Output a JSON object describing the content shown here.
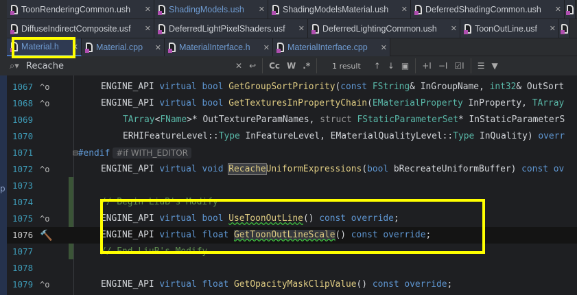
{
  "tabs_row1": [
    {
      "label": "ToonRenderingCommon.ush"
    },
    {
      "label": "ShadingModels.ush"
    },
    {
      "label": "ShadingModelsMaterial.ush"
    },
    {
      "label": "DeferredShadingCommon.ush"
    }
  ],
  "tabs_row2": [
    {
      "label": "DiffuseIndirectComposite.usf"
    },
    {
      "label": "DeferredLightPixelShaders.usf"
    },
    {
      "label": "DeferredLightingCommon.ush"
    },
    {
      "label": "ToonOutLine.usf"
    }
  ],
  "tabs_row3": [
    {
      "label": "Material.h"
    },
    {
      "label": "Material.cpp"
    },
    {
      "label": "MaterialInterface.h"
    },
    {
      "label": "MaterialInterface.cpp"
    }
  ],
  "search": {
    "value": "Recache",
    "case": "Cc",
    "words": "W",
    "regex": ".*",
    "results": "1 result"
  },
  "side_letter": "p",
  "lines": [
    "1067",
    "1068",
    "1069",
    "1070",
    "1071",
    "1072",
    "1073",
    "1074",
    "1075",
    "1076",
    "1077",
    "1078",
    "1079"
  ],
  "code": {
    "l1067": {
      "a": "ENGINE_API ",
      "b": "virtual bool ",
      "c": "GetGroupSortPriority",
      "d": "(",
      "e": "const ",
      "f": "FString",
      "g": "& InGroupName, ",
      "h": "int32",
      "i": "& OutSort"
    },
    "l1068": {
      "a": "ENGINE_API ",
      "b": "virtual bool ",
      "c": "GetTexturesInPropertyChain",
      "d": "(",
      "f": "EMaterialProperty",
      "g": " InProperty, ",
      "h": "TArray"
    },
    "l1069": {
      "a": "TArray",
      "b": "<",
      "c": "FName",
      "d": ">* OutTextureParamNames, ",
      "e": "struct ",
      "f": "FStaticParameterSet",
      "g": "* InStaticParameterS"
    },
    "l1070": {
      "a": "ERHIFeatureLevel::",
      "b": "Type",
      "c": " InFeatureLevel, EMaterialQualityLevel::",
      "d": "Type",
      "e": " InQuality) ",
      "f": "overr"
    },
    "l1071": {
      "a": "#endif",
      "hint": "#if WITH_EDITOR"
    },
    "l1072": {
      "a": "ENGINE_API ",
      "b": "virtual void ",
      "c": "Recache",
      "d": "UniformExpressions",
      "e": "(",
      "f": "bool",
      "g": " bRecreateUniformBuffer) ",
      "h": "const ov"
    },
    "l1074": "// Begin LiuB's Modify",
    "l1075": {
      "a": "ENGINE_API ",
      "b": "virtual bool ",
      "c": "UseToonOutLine",
      "d": "() ",
      "e": "const override",
      "f": ";"
    },
    "l1076": {
      "a": "ENGINE_API ",
      "b": "virtual float ",
      "c": "GetToonOutLineScale",
      "d": "() ",
      "e": "const override",
      "f": ";"
    },
    "l1077": "// End LiuB's Modify",
    "l1079": {
      "a": "ENGINE_API ",
      "b": "virtual float ",
      "c": "GetOpacityMaskClipValue",
      "d": "() ",
      "e": "const override",
      "f": ";"
    }
  }
}
